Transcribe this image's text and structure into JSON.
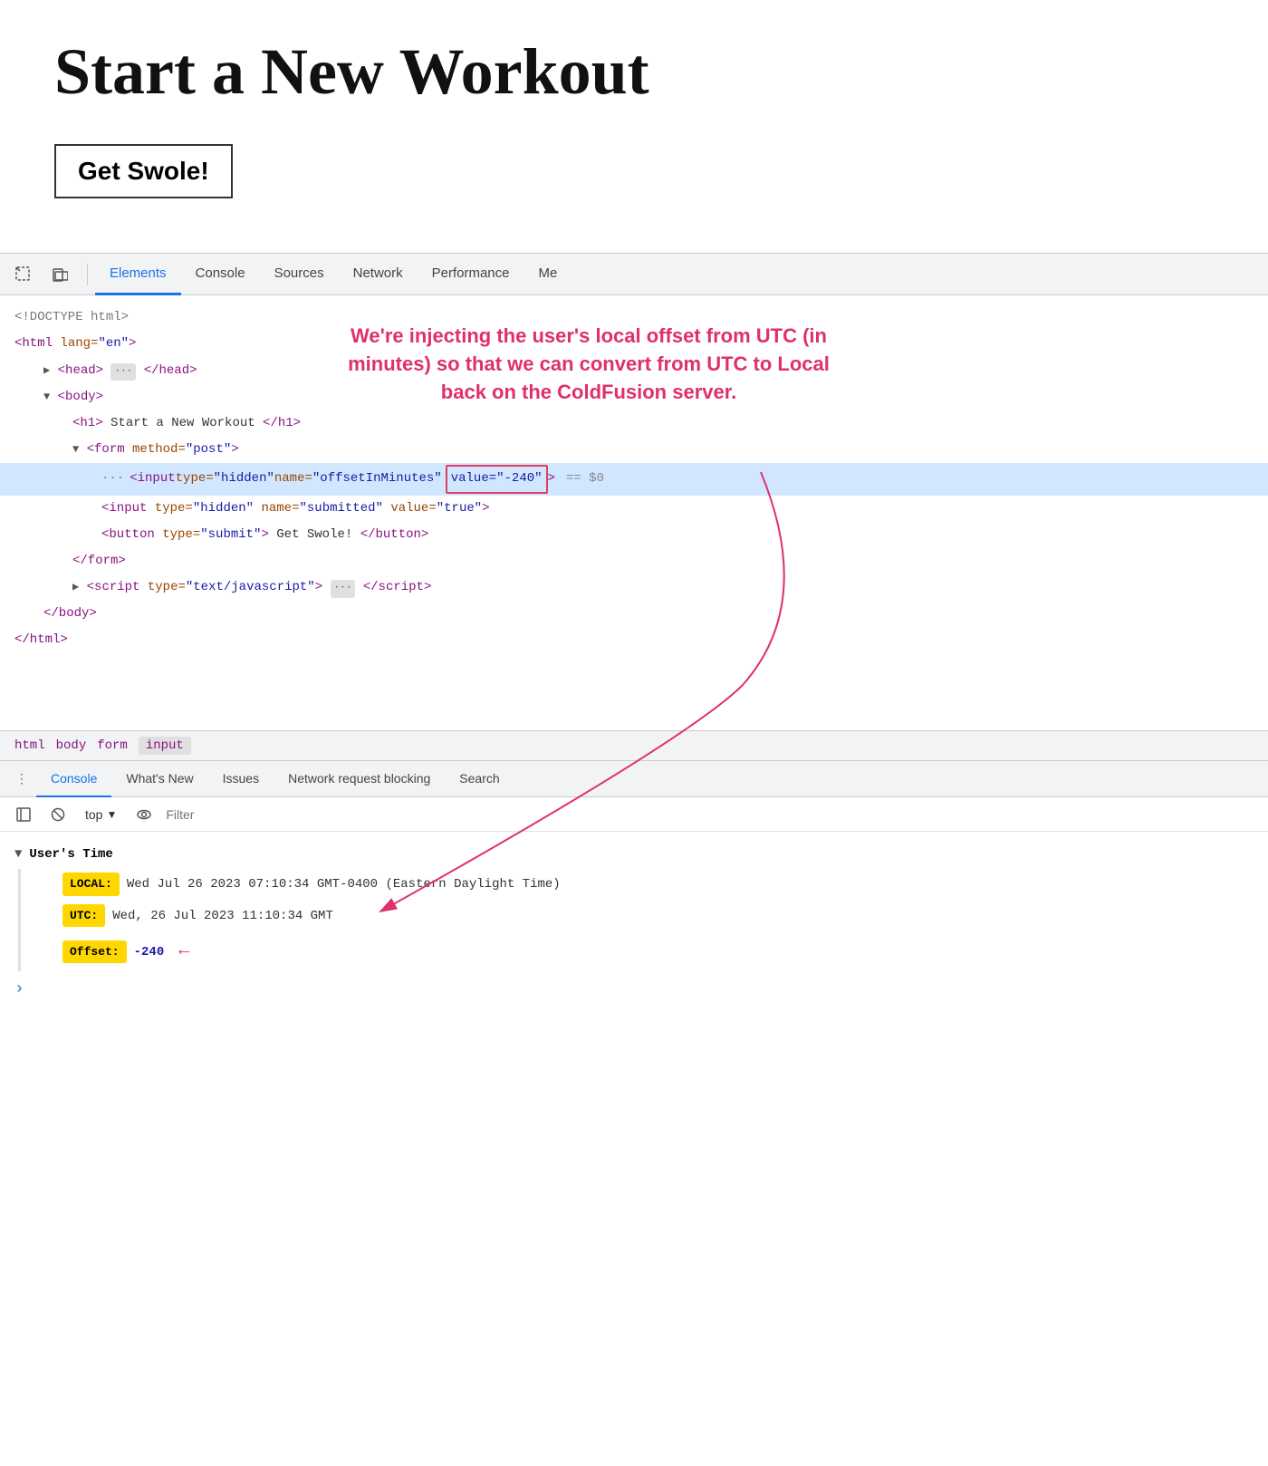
{
  "page": {
    "title": "Start a New Workout",
    "button_label": "Get Swole!"
  },
  "devtools": {
    "tabs": [
      {
        "label": "Elements",
        "active": true
      },
      {
        "label": "Console",
        "active": false
      },
      {
        "label": "Sources",
        "active": false
      },
      {
        "label": "Network",
        "active": false
      },
      {
        "label": "Performance",
        "active": false
      },
      {
        "label": "Me",
        "active": false
      }
    ],
    "dom": {
      "doctype": "<!DOCTYPE html>",
      "lines": [
        {
          "indent": 0,
          "content": "<html lang=\"en\">"
        },
        {
          "indent": 1,
          "content": "▶ <head> ··· </head>"
        },
        {
          "indent": 1,
          "content": "▼ <body>"
        },
        {
          "indent": 2,
          "content": "<h1> Start a New Workout </h1>"
        },
        {
          "indent": 2,
          "content": "▼ <form method=\"post\">"
        },
        {
          "indent": 3,
          "content": "<input type=\"hidden\" name=\"offsetInMinutes\" value=\"-240\">",
          "highlighted": true
        },
        {
          "indent": 3,
          "content": "<input type=\"hidden\" name=\"submitted\" value=\"true\">"
        },
        {
          "indent": 3,
          "content": "<button type=\"submit\"> Get Swole! </button>"
        },
        {
          "indent": 2,
          "content": "</form>"
        },
        {
          "indent": 1,
          "content": "▶ <script type=\"text/javascript\"> ··· <\\/script>"
        },
        {
          "indent": 1,
          "content": "</body>"
        },
        {
          "indent": 0,
          "content": "</html>"
        }
      ]
    },
    "annotation": {
      "text": "We're injecting the user's local offset from UTC (in minutes) so that we can convert from UTC to Local back on the ColdFusion server."
    },
    "breadcrumb": {
      "items": [
        "html",
        "body",
        "form",
        "input"
      ],
      "active": "input"
    },
    "console_tabs": [
      {
        "label": "Console",
        "active": true
      },
      {
        "label": "What's New",
        "active": false
      },
      {
        "label": "Issues",
        "active": false
      },
      {
        "label": "Network request blocking",
        "active": false
      },
      {
        "label": "Search",
        "active": false
      }
    ],
    "console": {
      "top_label": "top",
      "filter_placeholder": "Filter",
      "group_label": "User's Time",
      "rows": [
        {
          "badge": "LOCAL:",
          "value": "Wed Jul 26 2023 07:10:34 GMT-0400 (Eastern Daylight Time)"
        },
        {
          "badge": "UTC:",
          "value": "Wed, 26 Jul 2023 11:10:34 GMT"
        },
        {
          "badge": "Offset:",
          "value": "-240"
        }
      ]
    }
  }
}
